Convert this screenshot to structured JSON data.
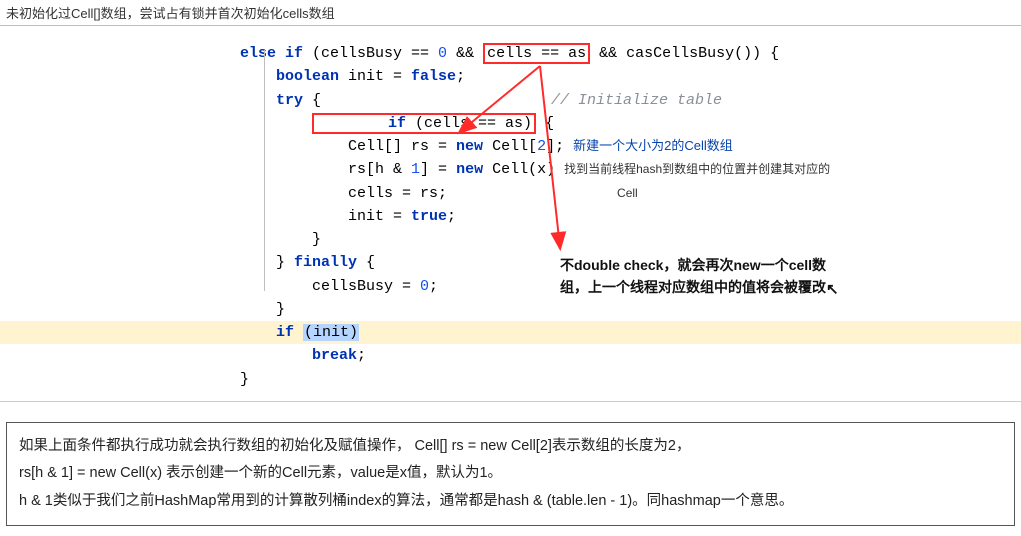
{
  "top_note": "未初始化过Cell[]数组，尝试占有锁并首次初始化cells数组",
  "code": {
    "l1a": "else if",
    "l1b": " (cellsBusy == ",
    "l1c": "0",
    "l1d": " && ",
    "l1e": "cells == as",
    "l1f": " && casCellsBusy()) {",
    "l2a": "    boolean",
    "l2b": " init = ",
    "l2c": "false",
    "l2d": ";",
    "l3a": "    try",
    "l3b": " {",
    "l3c": "// Initialize table",
    "l4a": "        if",
    "l4b": " (cells == as)",
    "l4c": " {",
    "l5a": "            Cell[] rs = ",
    "l5b": "new",
    "l5c": " Cell[",
    "l5d": "2",
    "l5e": "];",
    "l5note": "新建一个大小为2的Cell数组",
    "l6a": "            rs[h & ",
    "l6b": "1",
    "l6c": "] = ",
    "l6d": "new",
    "l6e": " Cell(x)",
    "l6note1": "找到当前线程hash到数组中的位置并创建其对应的",
    "l6note2": "Cell",
    "l7a": "            cells = rs;",
    "l8a": "            init = ",
    "l8b": "true",
    "l8c": ";",
    "l9a": "        }",
    "l10a": "    } ",
    "l10b": "finally",
    "l10c": " {",
    "l11a": "        cellsBusy = ",
    "l11b": "0",
    "l11c": ";",
    "l12a": "    }",
    "l13a": "    if ",
    "l13b": "(init)",
    "l14a": "        break",
    "l14b": ";",
    "l15a": "}"
  },
  "annotation": {
    "line1": "不double check，就会再次new一个cell数",
    "line2": "组，上一个线程对应数组中的值将会被覆改"
  },
  "bottom": {
    "p1": "如果上面条件都执行成功就会执行数组的初始化及赋值操作， Cell[] rs = new Cell[2]表示数组的长度为2，",
    "p2": "rs[h & 1] = new Cell(x) 表示创建一个新的Cell元素，value是x值，默认为1。",
    "p3": "h & 1类似于我们之前HashMap常用到的计算散列桶index的算法，通常都是hash & (table.len - 1)。同hashmap一个意思。"
  }
}
